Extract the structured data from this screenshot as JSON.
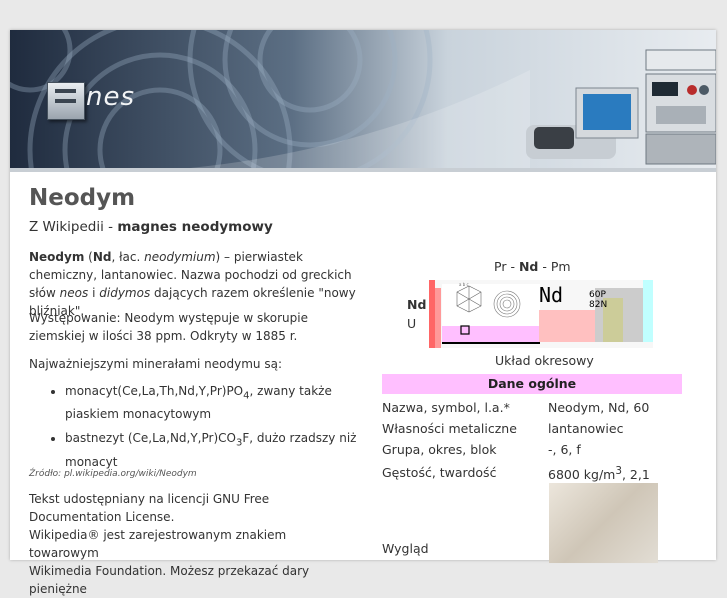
{
  "banner": {
    "logo_text": "nes"
  },
  "article": {
    "title": "Neodym",
    "subtitle_prefix": "Z Wikipedii - ",
    "subtitle_bold": "magnes neodymowy",
    "intro": {
      "name": "Neodym",
      "symbol": "Nd",
      "latin_prefix": "łac.",
      "latin": "neodymium",
      "rest1": "– pierwiastek chemiczny, lantanowiec. Nazwa pochodzi od greckich słów",
      "neos": "neos",
      "and": "i",
      "didymos": "didymos",
      "rest2": "dających razem określenie \"nowy bliźniak\"."
    },
    "occurrence": "Występowanie: Neodym występuje w skorupie ziemskiej w ilości 38 ppm. Odkryty w 1885 r.",
    "minerals_intro": "Najważniejszymi minerałami neodymu są:",
    "minerals": [
      {
        "formula_main": "monacyt(Ce,La,Th,Nd,Y,Pr)PO",
        "sub": "4",
        "rest": ", zwany także piaskiem monacytowym"
      },
      {
        "formula_main": "bastnezyt (Ce,La,Nd,Y,Pr)CO",
        "sub": "3",
        "rest": "F, dużo rzadszy niż monacyt"
      }
    ],
    "source": "Źródło: pl.wikipedia.org/wiki/Neodym",
    "license1": "Tekst udostępniany na licencji GNU Free Documentation License.",
    "license2": "Wikipedia® jest zarejestrowanym znakiem towarowym",
    "license3": "Wikimedia Foundation. Możesz przekazać dary pieniężne"
  },
  "infobox": {
    "nav_prev": "Pr",
    "nav_sep1": " - ",
    "nav_current": "Nd",
    "nav_sep2": " - ",
    "nav_next": "Pm",
    "side_symbol": "Nd",
    "side_state": "U",
    "pt_big_symbol": "Nd",
    "pt_shells": "60P",
    "pt_shells2": "82N",
    "pt_lattice_label": "a b c",
    "caption": "Układ okresowy",
    "header": "Dane ogólne",
    "rows": [
      {
        "key": "Nazwa, symbol, l.a.*",
        "value": "Neodym, Nd, 60"
      },
      {
        "key": "Własności metaliczne",
        "value": "lantanowiec"
      },
      {
        "key": "Grupa, okres, blok",
        "value": "-, 6, f"
      },
      {
        "key": "Gęstość, twardość",
        "value_main": "6800 kg/m",
        "value_sup": "3",
        "value_rest": ", 2,1"
      },
      {
        "key": "Wygląd"
      }
    ]
  },
  "colors": {
    "infobox_header_bg": "#ffbfff",
    "page_bg": "#e9e9e9"
  }
}
